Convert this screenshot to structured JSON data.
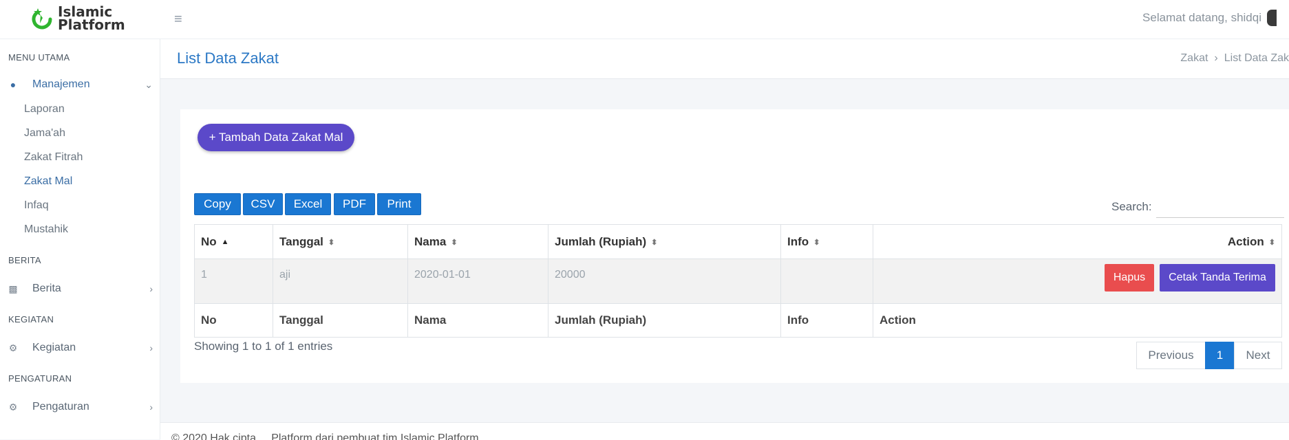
{
  "brand": {
    "line1": "Islamic",
    "line2": "Platform"
  },
  "topbar": {
    "welcome": "Selamat datang, shidqi"
  },
  "sidebar": {
    "sections": {
      "menu_utama": "MENU UTAMA",
      "berita": "BERITA",
      "kegiatan": "KEGIATAN",
      "pengaturan": "PENGATURAN"
    },
    "manajemen": {
      "label": "Manajemen",
      "subitems": [
        "Laporan",
        "Jama'ah",
        "Zakat Fitrah",
        "Zakat Mal",
        "Infaq",
        "Mustahik"
      ]
    },
    "berita_item": "Berita",
    "kegiatan_item": "Kegiatan",
    "pengaturan_item": "Pengaturan",
    "colors": {
      "active": "#3b6ea5",
      "text": "#6a7580"
    }
  },
  "header": {
    "title": "List Data Zakat",
    "breadcrumb": [
      "Zakat",
      "List Data Zak"
    ]
  },
  "main": {
    "add_button": "+ Tambah Data Zakat Mal",
    "export_buttons": [
      "Copy",
      "CSV",
      "Excel",
      "PDF",
      "Print"
    ],
    "search_label": "Search:",
    "search_value": "",
    "table": {
      "columns": [
        "No",
        "Tanggal",
        "Nama",
        "Jumlah (Rupiah)",
        "Info",
        "Action"
      ],
      "rows": [
        {
          "no": "1",
          "tanggal": "aji",
          "nama": "2020-01-01",
          "jumlah": "20000",
          "info": ""
        }
      ],
      "row_actions": {
        "delete": "Hapus",
        "print": "Cetak Tanda Terima"
      }
    },
    "info": "Showing 1 to 1 of 1 entries",
    "pagination": {
      "previous": "Previous",
      "current": "1",
      "next": "Next"
    }
  },
  "footer": {
    "text": "© 2020 Hak cipta ... Platform dari pembuat tim Islamic Platform"
  },
  "colors": {
    "primary": "#1a77d2",
    "accent": "#5b49c9",
    "danger": "#e94d4e",
    "title": "#2b78c5"
  }
}
